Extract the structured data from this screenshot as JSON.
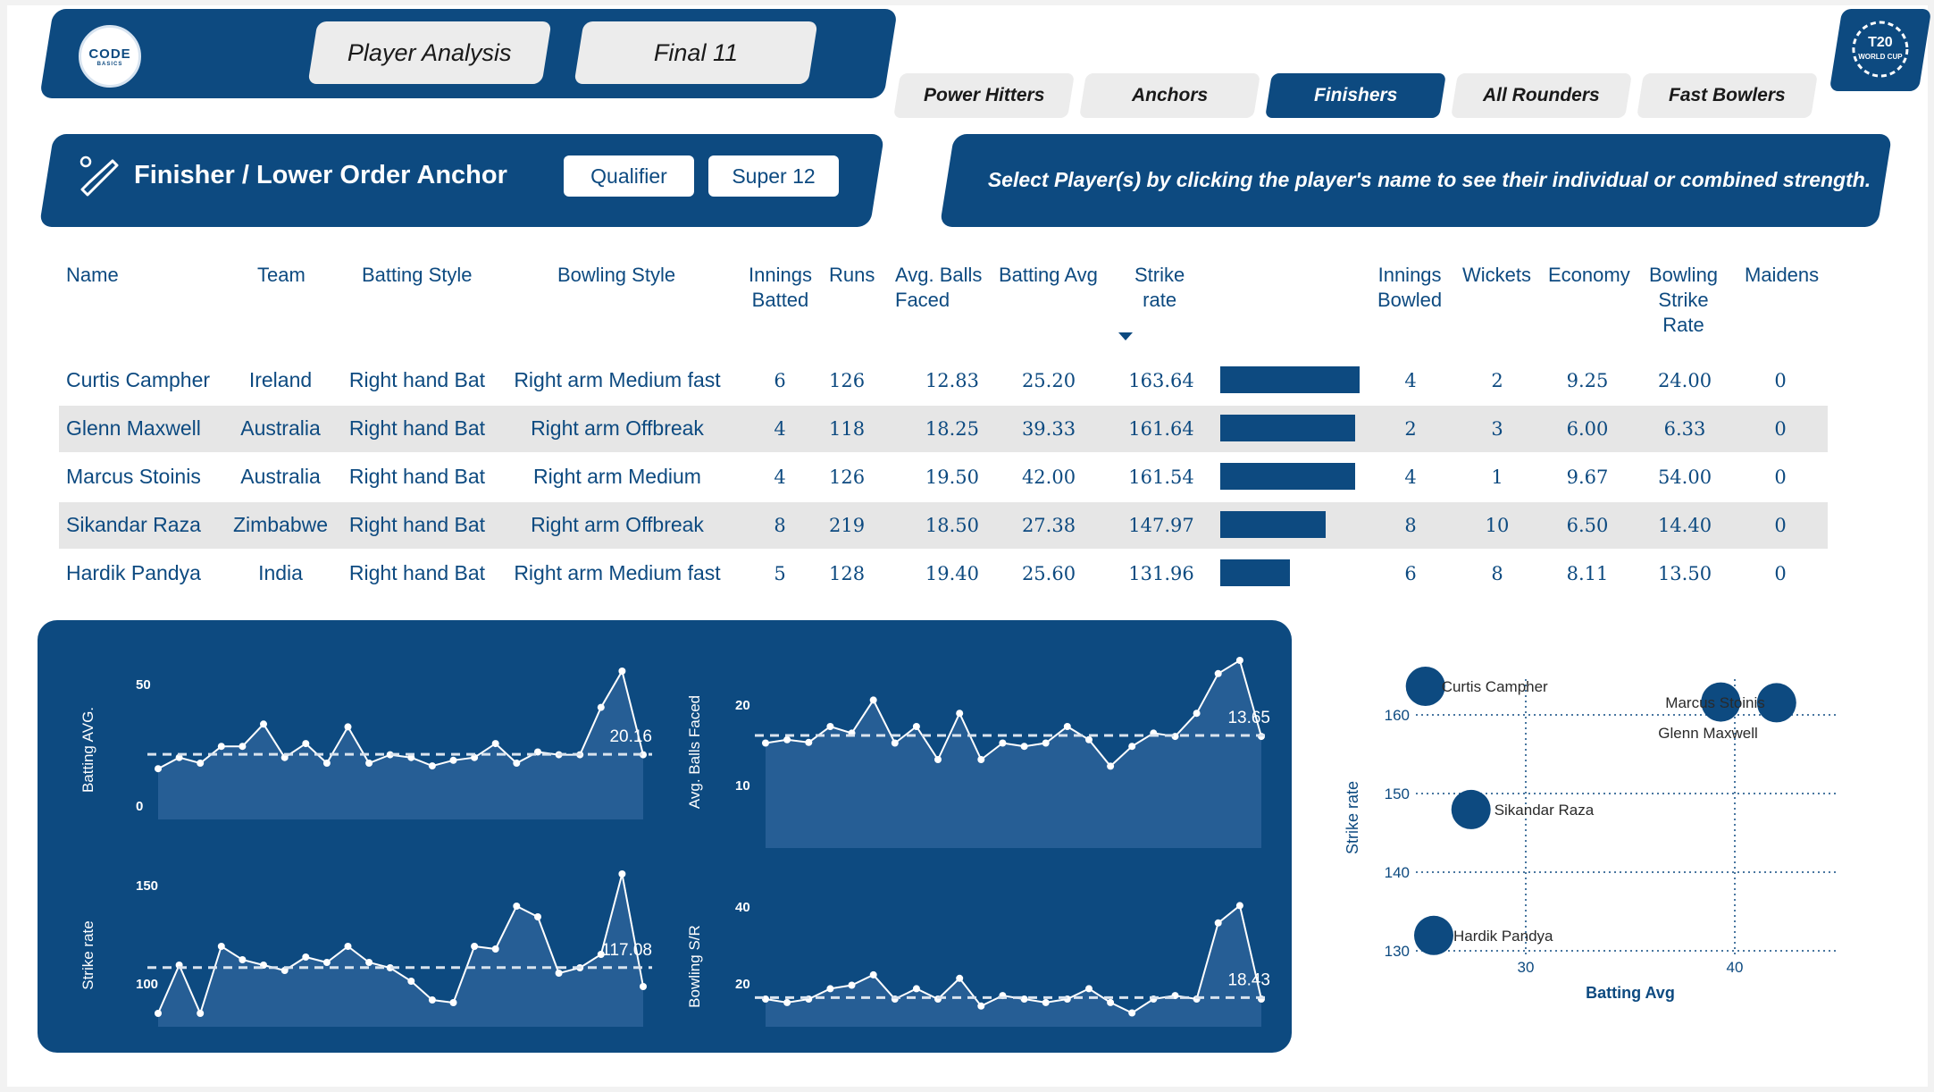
{
  "brand": {
    "logo_line1": "CODE",
    "logo_line2": "BASICS",
    "event_logo": "T20 MEN'S T20 WORLD CUP AUSTRALIA 2022"
  },
  "nav": {
    "player_analysis": "Player Analysis",
    "final11": "Final 11"
  },
  "tabs": [
    {
      "label": "Power Hitters",
      "active": false
    },
    {
      "label": "Anchors",
      "active": false
    },
    {
      "label": "Finishers",
      "active": true
    },
    {
      "label": "All Rounders",
      "active": false
    },
    {
      "label": "Fast Bowlers",
      "active": false
    }
  ],
  "section": {
    "title": "Finisher / Lower Order Anchor",
    "filter1": "Qualifier",
    "filter2": "Super 12"
  },
  "instruction": "Select Player(s) by clicking the player's name to see their individual or combined strength.",
  "columns": {
    "name": "Name",
    "team": "Team",
    "batting_style": "Batting Style",
    "bowling_style": "Bowling Style",
    "innings_batted_1": "Innings",
    "innings_batted_2": "Batted",
    "runs": "Runs",
    "avg_balls_1": "Avg. Balls",
    "avg_balls_2": "Faced",
    "batting_avg": "Batting Avg",
    "strike_rate_1": "Strike",
    "strike_rate_2": "rate",
    "innings_bowled_1": "Innings",
    "innings_bowled_2": "Bowled",
    "wickets": "Wickets",
    "economy": "Economy",
    "bowling_sr_1": "Bowling",
    "bowling_sr_2": "Strike",
    "bowling_sr_3": "Rate",
    "maidens": "Maidens"
  },
  "players": [
    {
      "name": "Curtis Campher",
      "team": "Ireland",
      "bat": "Right hand Bat",
      "bowl": "Right arm Medium fast",
      "inn": "6",
      "runs": "126",
      "abf": "12.83",
      "avg": "25.20",
      "sr": "163.64",
      "sr_value": 163.64,
      "innb": "4",
      "wk": "2",
      "eco": "9.25",
      "bsr": "24.00",
      "md": "0"
    },
    {
      "name": "Glenn Maxwell",
      "team": "Australia",
      "bat": "Right hand Bat",
      "bowl": "Right arm Offbreak",
      "inn": "4",
      "runs": "118",
      "abf": "18.25",
      "avg": "39.33",
      "sr": "161.64",
      "sr_value": 161.64,
      "innb": "2",
      "wk": "3",
      "eco": "6.00",
      "bsr": "6.33",
      "md": "0"
    },
    {
      "name": "Marcus Stoinis",
      "team": "Australia",
      "bat": "Right hand Bat",
      "bowl": "Right arm Medium",
      "inn": "4",
      "runs": "126",
      "abf": "19.50",
      "avg": "42.00",
      "sr": "161.54",
      "sr_value": 161.54,
      "innb": "4",
      "wk": "1",
      "eco": "9.67",
      "bsr": "54.00",
      "md": "0"
    },
    {
      "name": "Sikandar Raza",
      "team": "Zimbabwe",
      "bat": "Right hand Bat",
      "bowl": "Right arm Offbreak",
      "inn": "8",
      "runs": "219",
      "abf": "18.50",
      "avg": "27.38",
      "sr": "147.97",
      "sr_value": 147.97,
      "innb": "8",
      "wk": "10",
      "eco": "6.50",
      "bsr": "14.40",
      "md": "0"
    },
    {
      "name": "Hardik Pandya",
      "team": "India",
      "bat": "Right hand Bat",
      "bowl": "Right arm Medium fast",
      "inn": "5",
      "runs": "128",
      "abf": "19.40",
      "avg": "25.60",
      "sr": "131.96",
      "sr_value": 131.96,
      "innb": "6",
      "wk": "8",
      "eco": "8.11",
      "bsr": "13.50",
      "md": "0"
    }
  ],
  "chart_data": [
    {
      "type": "area",
      "ylabel": "Batting AVG.",
      "yticks": [
        "0",
        "50"
      ],
      "ylim": [
        0,
        50
      ],
      "avg_label": "20.16",
      "avg": 20.16,
      "values": [
        15,
        19,
        17,
        23,
        23,
        31,
        19,
        24,
        17,
        30,
        17,
        20,
        19,
        16,
        18,
        19,
        24,
        17,
        21,
        20,
        20,
        37,
        50,
        20
      ]
    },
    {
      "type": "area",
      "ylabel": "Avg. Balls Faced",
      "yticks": [
        "10",
        "20"
      ],
      "ylim": [
        0,
        25
      ],
      "avg_label": "13.65",
      "avg": 13.65,
      "values": [
        12.5,
        13,
        12.6,
        15,
        14,
        19,
        12.5,
        15,
        10,
        17,
        10,
        12.5,
        12,
        12.5,
        15,
        13,
        9,
        12,
        14,
        13.5,
        17,
        23,
        25,
        13.5
      ]
    },
    {
      "type": "area",
      "ylabel": "Strike rate",
      "yticks": [
        "100",
        "150"
      ],
      "ylim": [
        95,
        155
      ],
      "avg_label": "117.08",
      "avg": 117.08,
      "values": [
        100,
        118,
        100,
        125,
        120,
        118,
        116,
        121,
        119,
        125,
        119,
        117,
        112,
        105,
        104,
        125,
        124,
        140,
        136,
        115,
        117,
        122,
        152,
        110
      ]
    },
    {
      "type": "area",
      "ylabel": "Bowling S/R",
      "yticks": [
        "20",
        "40"
      ],
      "ylim": [
        10,
        50
      ],
      "avg_label": "18.43",
      "avg": 18.43,
      "values": [
        18,
        17,
        18,
        21,
        22,
        25,
        18,
        21,
        18,
        24,
        16,
        19,
        18,
        17,
        18,
        21,
        17,
        14,
        18,
        19,
        18,
        40,
        45,
        18
      ]
    },
    {
      "type": "scatter",
      "xlabel": "Batting Avg",
      "ylabel": "Strike rate",
      "xticks": [
        "30",
        "40"
      ],
      "yticks": [
        "130",
        "140",
        "150",
        "160"
      ],
      "points": [
        {
          "label": "Curtis Campher",
          "x": 25.2,
          "y": 163.64
        },
        {
          "label": "Marcus Stoinis",
          "x": 42.0,
          "y": 161.54
        },
        {
          "label": "Glenn Maxwell",
          "x": 39.33,
          "y": 161.64
        },
        {
          "label": "Sikandar Raza",
          "x": 27.38,
          "y": 147.97
        },
        {
          "label": "Hardik Pandya",
          "x": 25.6,
          "y": 131.96
        }
      ]
    }
  ]
}
